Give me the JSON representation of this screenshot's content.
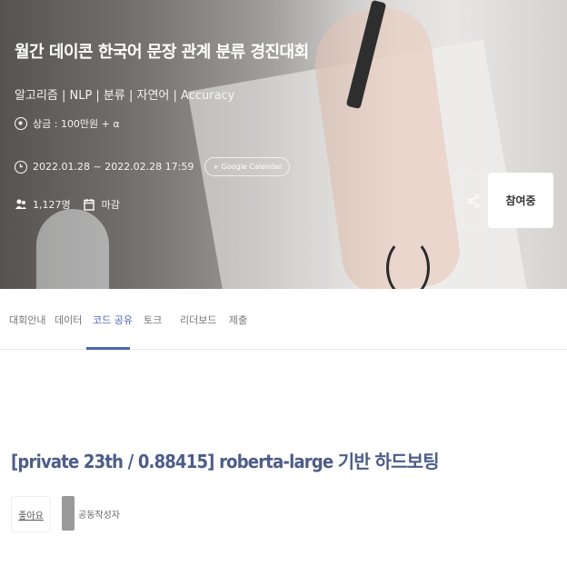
{
  "hero": {
    "title": "월간 데이콘 한국어 문장 관계 분류 경진대회",
    "tags": "알고리즘 | NLP | 분류 | 자연어 | Accuracy",
    "prize": "상금 : 100만원 + α",
    "period": "2022.01.28 ~ 2022.02.28 17:59",
    "google_calendar": "+ Google Calendar",
    "participants": "1,127명",
    "status": "마감",
    "join_button": "참여중"
  },
  "tabs": [
    {
      "label": "대회안내"
    },
    {
      "label": "데이터"
    },
    {
      "label": "코드 공유"
    },
    {
      "label": "토크"
    },
    {
      "label": "리더보드"
    },
    {
      "label": "제출"
    }
  ],
  "post": {
    "title": "[private 23th / 0.88415] roberta-large 기반 하드보팅",
    "upvote_label": "좋아요",
    "coauthor_label": "공동작성자"
  },
  "colors": {
    "accent": "#4a67b3",
    "post_title": "#4c5d88"
  }
}
